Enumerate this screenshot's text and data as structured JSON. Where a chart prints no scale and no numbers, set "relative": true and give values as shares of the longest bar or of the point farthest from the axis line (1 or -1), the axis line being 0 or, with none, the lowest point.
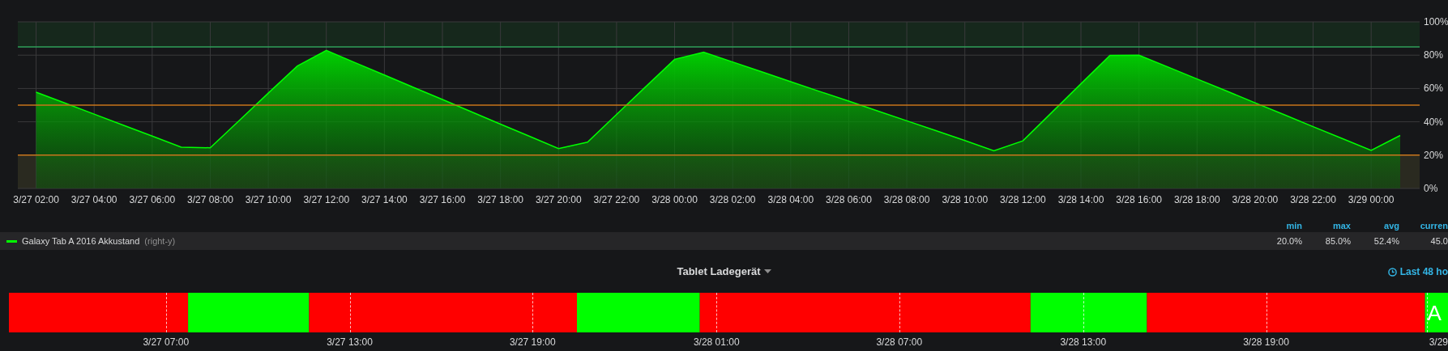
{
  "graph_panel": {
    "chart_data": {
      "type": "area",
      "categories": [
        "3/27 02:00",
        null,
        "3/27 04:00",
        null,
        "3/27 06:00",
        null,
        "3/27 08:00",
        null,
        "3/27 10:00",
        null,
        "3/27 12:00",
        null,
        "3/27 14:00",
        null,
        "3/27 16:00",
        null,
        "3/27 18:00",
        null,
        "3/27 20:00",
        null,
        "3/27 22:00",
        null,
        "3/28 00:00",
        null,
        "3/28 02:00",
        null,
        "3/28 04:00",
        null,
        "3/28 06:00",
        null,
        "3/28 08:00",
        null,
        "3/28 10:00",
        null,
        "3/28 12:00",
        null,
        "3/28 14:00",
        null,
        "3/28 16:00",
        null,
        "3/28 18:00",
        null,
        "3/28 20:00",
        null,
        "3/28 22:00",
        null,
        "3/29 00:00",
        null
      ],
      "series": [
        {
          "name": "Galaxy Tab A 2016 Akkustand",
          "color": "#00ff00",
          "values": [
            57.8,
            51.2,
            44.6,
            38.0,
            31.4,
            24.8,
            24.4,
            40.8,
            57.2,
            73.5,
            82.8,
            75.4,
            68.1,
            60.7,
            53.4,
            46.0,
            38.6,
            31.3,
            23.9,
            27.8,
            44.4,
            61.0,
            77.5,
            81.8,
            75.9,
            70.0,
            64.1,
            58.2,
            52.4,
            46.5,
            40.6,
            34.7,
            28.8,
            22.6,
            28.6,
            45.7,
            62.8,
            79.9,
            80.0,
            72.9,
            65.7,
            58.6,
            51.4,
            44.3,
            37.1,
            30.0,
            22.9,
            31.8
          ]
        }
      ],
      "ylim": [
        0,
        100
      ],
      "grid": true,
      "yticks": [
        {
          "value": 0,
          "label": "0%"
        },
        {
          "value": 20,
          "label": "20%"
        },
        {
          "value": 40,
          "label": "40%"
        },
        {
          "value": 60,
          "label": "60%"
        },
        {
          "value": 80,
          "label": "80%"
        },
        {
          "value": 100,
          "label": "100%"
        }
      ],
      "bands": [
        {
          "axis": "y",
          "from": 85,
          "to": 100,
          "color": "#16281c"
        },
        {
          "axis": "y",
          "from": 0,
          "to": 20,
          "color": "#2a2a20"
        }
      ],
      "ref_lines": [
        {
          "axis": "y",
          "value": 85,
          "color": "#2fa05a"
        },
        {
          "axis": "y",
          "value": 50,
          "color": "#c8741a"
        },
        {
          "axis": "y",
          "value": 20,
          "color": "#c8741a"
        }
      ]
    },
    "legend": {
      "headers": [
        "min",
        "max",
        "avg",
        "curren"
      ],
      "series": [
        {
          "axis": "(right-y)",
          "stats": [
            "20.0%",
            "85.0%",
            "52.4%",
            "45.0"
          ]
        }
      ]
    }
  },
  "status_panel": {
    "title": "Tablet Ladegerät",
    "time_range": "Last 48 ho",
    "chart_data": {
      "type": "bar",
      "orientation": "horizontal",
      "stacked": true,
      "relative": true,
      "categories": [
        null
      ],
      "series": [
        {
          "color": "#ff0000",
          "values": [
            0.1245
          ]
        },
        {
          "color": "#00ff00",
          "values": [
            0.0841
          ]
        },
        {
          "color": "#ff0000",
          "values": [
            0.1861
          ]
        },
        {
          "color": "#00ff00",
          "values": [
            0.0854
          ]
        },
        {
          "color": "#ff0000",
          "values": [
            0.2298
          ]
        },
        {
          "color": "#00ff00",
          "values": [
            0.0809
          ]
        },
        {
          "color": "#ff0000",
          "values": [
            0.1932
          ]
        },
        {
          "color": "#00ff00",
          "values": [
            0.016
          ]
        }
      ],
      "value_labels": [
        null,
        null,
        null,
        null,
        null,
        null,
        null,
        "A"
      ]
    },
    "ticks": [
      {
        "label": "3/27 07:00",
        "level": 0.1091
      },
      {
        "label": "3/27 13:00",
        "level": 0.2368
      },
      {
        "label": "3/27 19:00",
        "level": 0.3639
      },
      {
        "label": "3/28 01:00",
        "level": 0.4917
      },
      {
        "label": "3/28 07:00",
        "level": 0.6187
      },
      {
        "label": "3/28 13:00",
        "level": 0.7465
      },
      {
        "label": "3/28 19:00",
        "level": 0.8736
      },
      {
        "label": "3/29",
        "level": 0.9852
      }
    ]
  }
}
